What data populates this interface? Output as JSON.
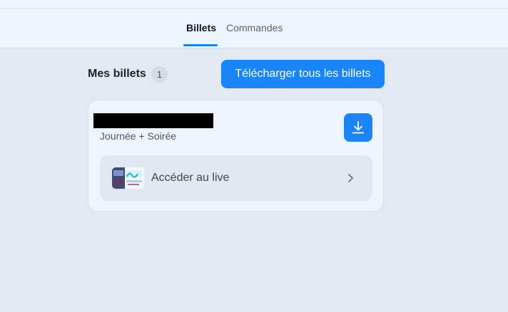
{
  "tabs": {
    "billets": "Billets",
    "commandes": "Commandes"
  },
  "main": {
    "heading": "Mes billets",
    "count": "1",
    "download_all_label": "Télécharger tous les billets"
  },
  "ticket": {
    "type": "Journée + Soirée",
    "live_label": "Accéder au live"
  },
  "icons": {
    "download": "download-icon",
    "chevron": "chevron-right-icon",
    "thumbnail": "event-thumbnail"
  },
  "colors": {
    "accent": "#1a85f8",
    "page_bg": "#e2e9f3",
    "card_bg": "#edf4fd"
  }
}
